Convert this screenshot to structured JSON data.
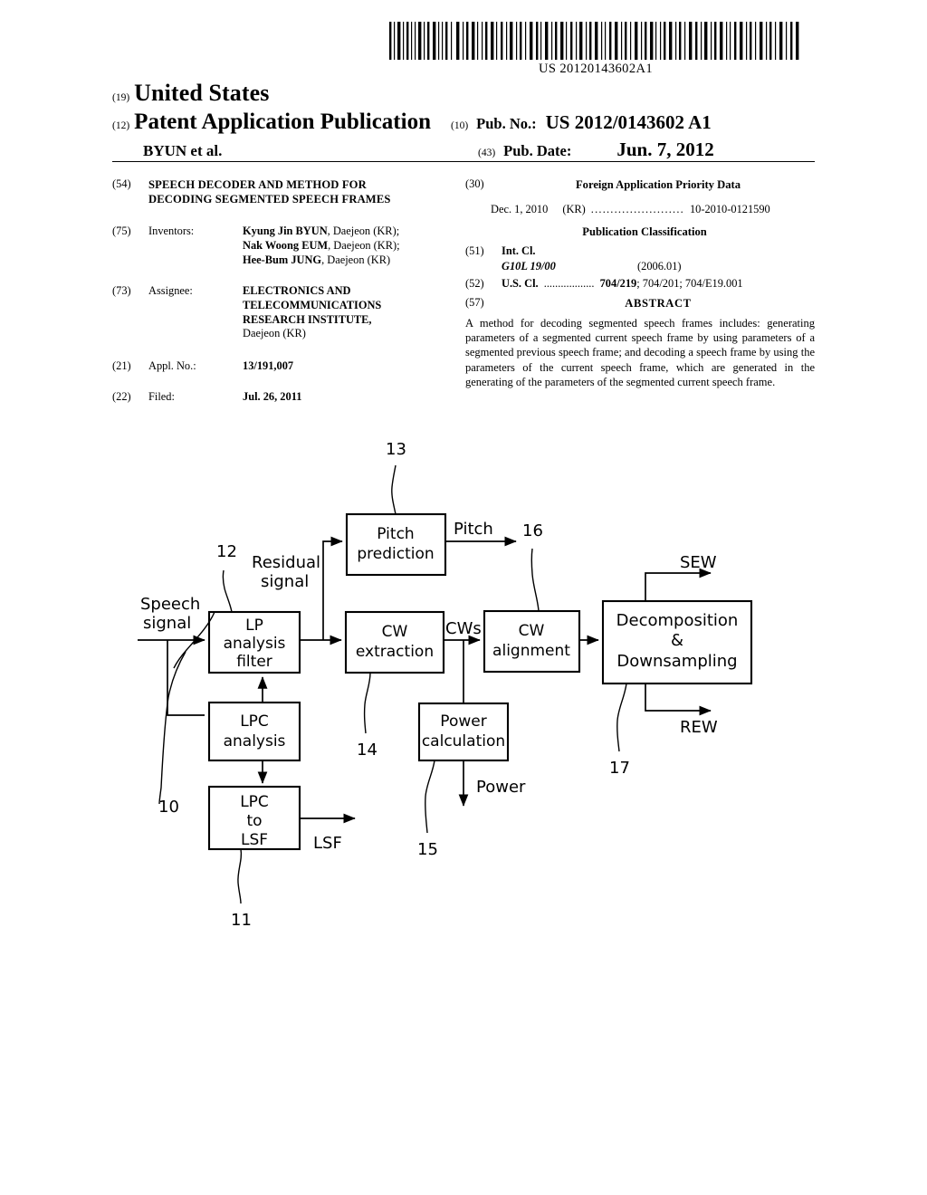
{
  "barcode": {
    "number": "US 20120143602A1",
    "icon": "barcode-icon"
  },
  "masthead": {
    "country_code": "(19)",
    "country": "United States",
    "doc_code": "(12)",
    "doc_type": "Patent Application Publication",
    "byline": "BYUN et al.",
    "pubno_code": "(10)",
    "pubno_label": "Pub. No.:",
    "pubno_value": "US 2012/0143602 A1",
    "pubdate_code": "(43)",
    "pubdate_label": "Pub. Date:",
    "pubdate_value": "Jun. 7, 2012"
  },
  "left_column": {
    "title_code": "(54)",
    "title_line1": "SPEECH DECODER AND METHOD FOR",
    "title_line2": "DECODING SEGMENTED SPEECH FRAMES",
    "inventors_code": "(75)",
    "inventors_label": "Inventors:",
    "inventors": [
      {
        "name": "Kyung Jin BYUN",
        "location": ", Daejeon (KR);"
      },
      {
        "name": "Nak Woong EUM",
        "location": ", Daejeon (KR);"
      },
      {
        "name": "Hee-Bum JUNG",
        "location": ", Daejeon (KR)"
      }
    ],
    "assignee_code": "(73)",
    "assignee_label": "Assignee:",
    "assignee_line1": "ELECTRONICS AND",
    "assignee_line2": "TELECOMMUNICATIONS",
    "assignee_line3": "RESEARCH INSTITUTE,",
    "assignee_line4": "Daejeon (KR)",
    "applno_code": "(21)",
    "applno_label": "Appl. No.:",
    "applno_value": "13/191,007",
    "filed_code": "(22)",
    "filed_label": "Filed:",
    "filed_value": "Jul. 26, 2011"
  },
  "right_column": {
    "priority_code": "(30)",
    "priority_heading": "Foreign Application Priority Data",
    "priority_date": "Dec. 1, 2010",
    "priority_country": "(KR)",
    "priority_dots": "........................",
    "priority_number": "10-2010-0121590",
    "pubclass_heading": "Publication Classification",
    "intcl_code": "(51)",
    "intcl_label": "Int. Cl.",
    "intcl_class": "G10L 19/00",
    "intcl_version": "(2006.01)",
    "uscl_code": "(52)",
    "uscl_label": "U.S. Cl.",
    "uscl_dots": "..................",
    "uscl_primary": "704/219",
    "uscl_rest": "; 704/201; 704/E19.001",
    "abstract_code": "(57)",
    "abstract_heading": "ABSTRACT",
    "abstract_text": "A method for decoding segmented speech frames includes: generating parameters of a segmented current speech frame by using parameters of a segmented previous speech frame; and decoding a speech frame by using the parameters of the current speech frame, which are generated in the generating of the parameters of the segmented current speech frame."
  },
  "figure": {
    "blocks": {
      "lp_analysis_filter": {
        "line1": "LP",
        "line2": "analysis",
        "line3": "filter"
      },
      "lpc_analysis": {
        "line1": "LPC",
        "line2": "analysis"
      },
      "lpc_to_lsf": {
        "line1": "LPC",
        "line2": "to",
        "line3": "LSF"
      },
      "pitch_prediction": {
        "line1": "Pitch",
        "line2": "prediction"
      },
      "cw_extraction": {
        "line1": "CW",
        "line2": "extraction"
      },
      "power_calculation": {
        "line1": "Power",
        "line2": "calculation"
      },
      "cw_alignment": {
        "line1": "CW",
        "line2": "alignment"
      },
      "decomposition": {
        "line1": "Decomposition",
        "line2": "&",
        "line3": "Downsampling"
      }
    },
    "labels": {
      "speech_signal_1": "Speech",
      "speech_signal_2": "signal",
      "residual_1": "Residual",
      "residual_2": "signal",
      "pitch": "Pitch",
      "cws": "CWs",
      "power": "Power",
      "lsf": "LSF",
      "sew": "SEW",
      "rew": "REW"
    },
    "refnums": {
      "r10": "10",
      "r11": "11",
      "r12": "12",
      "r13": "13",
      "r14": "14",
      "r15": "15",
      "r16": "16",
      "r17": "17"
    }
  }
}
